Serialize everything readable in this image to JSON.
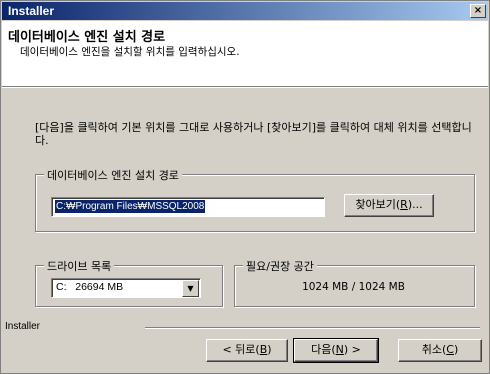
{
  "window": {
    "title": "Installer",
    "close_glyph": "×"
  },
  "header": {
    "title": "데이터베이스 엔진 설치 경로",
    "subtitle": "데이터베이스 엔진을 설치할 위치를 입력하십시오."
  },
  "instructions": "[다음]을 클릭하여 기본 위치를 그대로 사용하거나 [찾아보기]를 클릭하여 대체 위치를 선택합니다.",
  "install_path": {
    "legend": "데이터베이스 엔진 설치 경로",
    "value": "C:₩Program Files₩MSSQL2008",
    "browse_label": "찾아보기(",
    "browse_key": "R",
    "browse_suffix": ")..."
  },
  "drive": {
    "legend": "드라이브 목록",
    "selected": "C:   26694 MB",
    "arrow": "▼"
  },
  "space": {
    "legend": "필요/권장 공간",
    "value": "1024 MB / 1024 MB"
  },
  "footer": {
    "brand": "Installer",
    "back_prefix": "< 뒤로(",
    "back_key": "B",
    "back_suffix": ")",
    "next_prefix": "다음(",
    "next_key": "N",
    "next_suffix": ") >",
    "cancel_prefix": "취소(",
    "cancel_key": "C",
    "cancel_suffix": ")"
  },
  "colors": {
    "title_start": "#0a246a",
    "title_end": "#a6caf0",
    "face": "#d4d0c8"
  }
}
